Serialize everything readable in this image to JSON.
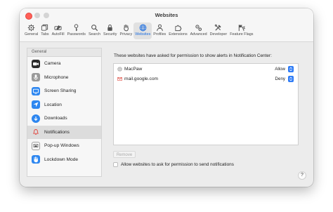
{
  "window": {
    "title": "Websites",
    "accent": "#2f7cf6"
  },
  "toolbar": {
    "tabs": [
      {
        "label": "General",
        "icon": "gear-icon"
      },
      {
        "label": "Tabs",
        "icon": "tabs-icon"
      },
      {
        "label": "AutoFill",
        "icon": "autofill-icon"
      },
      {
        "label": "Passwords",
        "icon": "key-icon"
      },
      {
        "label": "Search",
        "icon": "search-icon"
      },
      {
        "label": "Security",
        "icon": "lock-icon"
      },
      {
        "label": "Privacy",
        "icon": "hand-icon"
      },
      {
        "label": "Websites",
        "icon": "globe-icon",
        "active": true
      },
      {
        "label": "Profiles",
        "icon": "person-icon"
      },
      {
        "label": "Extensions",
        "icon": "puzzle-icon"
      },
      {
        "label": "Advanced",
        "icon": "gears-icon"
      },
      {
        "label": "Developer",
        "icon": "tools-icon"
      },
      {
        "label": "Feature Flags",
        "icon": "flags-icon"
      }
    ]
  },
  "sidebar": {
    "header": "General",
    "items": [
      {
        "label": "Camera",
        "icon": "camera-icon"
      },
      {
        "label": "Microphone",
        "icon": "microphone-icon"
      },
      {
        "label": "Screen Sharing",
        "icon": "screen-sharing-icon"
      },
      {
        "label": "Location",
        "icon": "location-icon"
      },
      {
        "label": "Downloads",
        "icon": "downloads-icon"
      },
      {
        "label": "Notifications",
        "icon": "bell-icon",
        "selected": true
      },
      {
        "label": "Pop-up Windows",
        "icon": "popup-icon"
      },
      {
        "label": "Lockdown Mode",
        "icon": "lockdown-hand-icon"
      }
    ]
  },
  "main": {
    "description": "These websites have asked for permission to show alerts in Notification Center:",
    "sites": [
      {
        "name": "MacPaw",
        "permission": "Allow",
        "icon": "globe-favicon-icon"
      },
      {
        "name": "mail.google.com",
        "permission": "Deny",
        "icon": "gmail-favicon-icon"
      }
    ],
    "remove_label": "Remove",
    "allow_checkbox_label": "Allow websites to ask for permission to send notifications",
    "help_label": "?"
  }
}
